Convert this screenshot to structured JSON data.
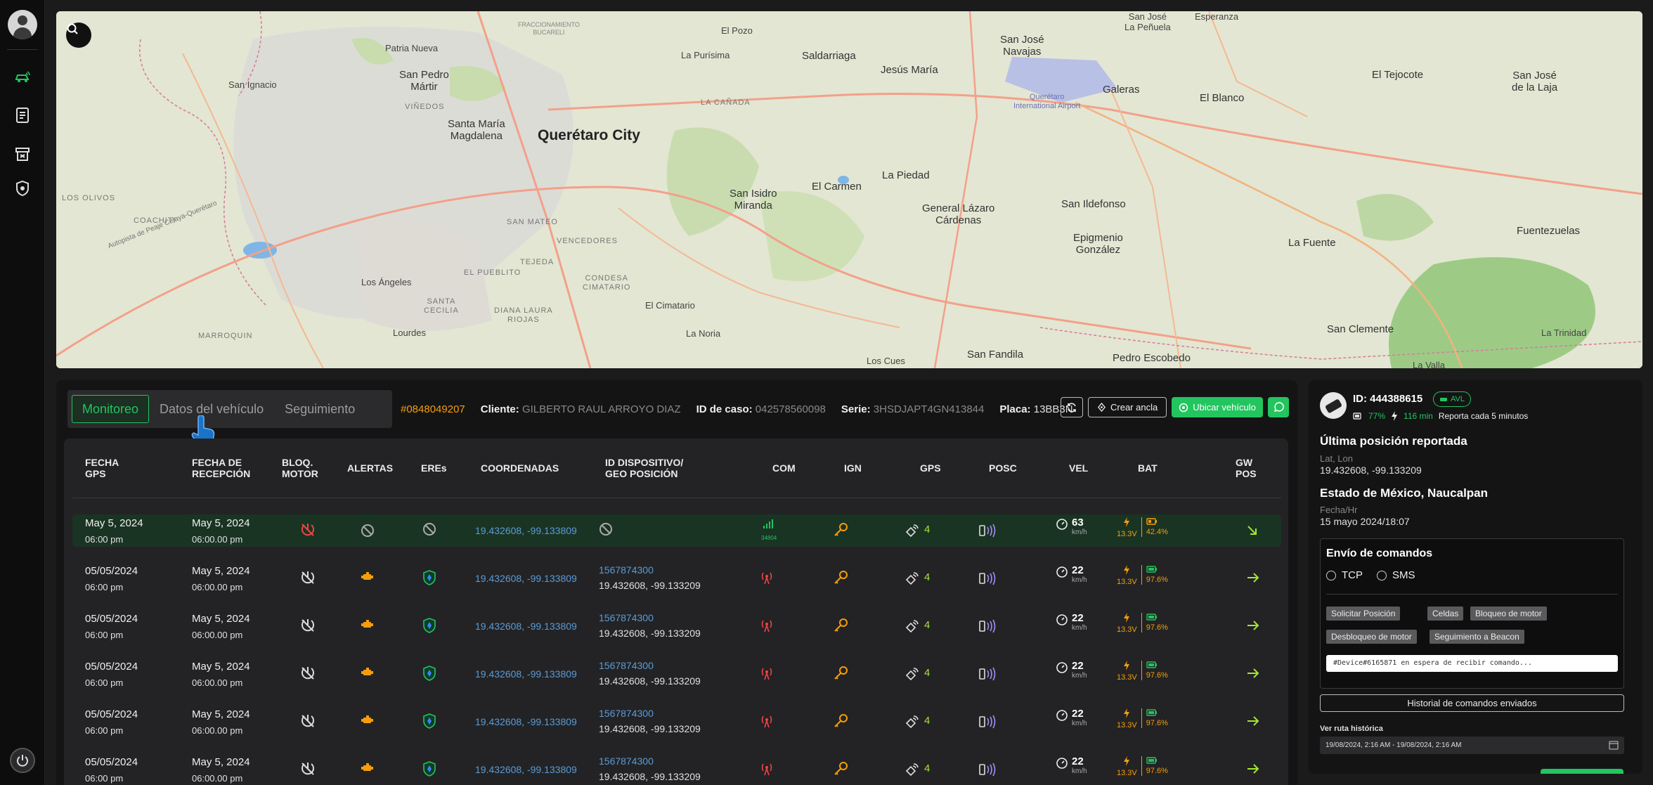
{
  "map": {
    "labels": {
      "city": "Querétaro City",
      "santa_maria": "Santa María\nMagdalena",
      "san_pedro": "San Pedro\nMártir",
      "patria_nueva": "Patria Nueva",
      "san_ignacio": "San Ignacio",
      "la_purisima": "La Purísima",
      "el_pozo": "El Pozo",
      "saldarriaga": "Saldarriaga",
      "jesus_maria": "Jesús María",
      "san_jose_navajas": "San José\nNavajas",
      "airport": "Querétaro\nInternational Airport",
      "galeras": "Galeras",
      "esperanza": "Esperanza",
      "san_jose_penuela": "San José\nLa Peñuela",
      "el_blanco": "El Blanco",
      "el_tejocote": "El Tejocote",
      "san_jose_laja": "San José\nde la Laja",
      "la_canada": "LA CAÑADA",
      "san_isidro": "San Isidro\nMiranda",
      "el_carmen": "El Carmen",
      "la_piedad": "La Piedad",
      "gral_lazaro": "General Lázaro\nCárdenas",
      "san_ildefonso": "San Ildefonso",
      "epigmenio": "Epigmenio\nGonzález",
      "la_fuente": "La Fuente",
      "fuentezuelas": "Fuentezuelas",
      "los_olivos": "LOS OLIVOS",
      "coachiti": "COACHITI",
      "san_mateo": "SAN MATEO",
      "vencedores": "VENCEDORES",
      "tejeda": "TEJEDA",
      "el_pueblito": "EL PUEBLITO",
      "condesa": "CONDESA\nCIMATARIO",
      "el_cimatario": "El Cimatario",
      "los_angeles": "Los Ángeles",
      "santa_cecilia": "SANTA\nCECILIA",
      "diana_laura": "DIANA LAURA\nRIOJAS",
      "marroquin": "MARROQUIN",
      "lourdes": "Lourdes",
      "la_noria": "La Noria",
      "los_cues": "Los Cues",
      "san_fandila": "San Fandila",
      "pedro_escobedo": "Pedro Escobedo",
      "san_clemente": "San Clemente",
      "la_trinidad": "La Trinidad",
      "la_valla": "La Valla",
      "vinedos": "VIÑEDOS",
      "bucareli": "FRACCIONAMIENTO\nBUCARELI",
      "autopista": "Autopista de Peaje Celaya-Querétaro"
    }
  },
  "tabs": [
    "Monitoreo",
    "Datos del vehículo",
    "Seguimiento"
  ],
  "info": {
    "device_no": "#0848049207",
    "cliente_label": "Cliente:",
    "cliente": "GILBERTO RAUL ARROYO DIAZ",
    "caso_label": "ID de caso:",
    "caso": "042578560098",
    "serie_label": "Serie:",
    "serie": "3HSDJAPT4GN413844",
    "placa_label": "Placa:",
    "placa": "13BB3N"
  },
  "buttons": {
    "crear_ancla": "Crear ancla",
    "ubicar": "Ubicar vehículo"
  },
  "table": {
    "headers": [
      "FECHA\nGPS",
      "FECHA DE\nRECEPCIÓN",
      "BLOQ.\nMOTOR",
      "ALERTAS",
      "EREs",
      "COORDENADAS",
      "ID DISPOSITIVO/\nGEO POSICIÓN",
      "COM",
      "IGN",
      "GPS",
      "POSC",
      "VEL",
      "BAT",
      "GW\nPOS"
    ],
    "rows": [
      {
        "fecha": "May 5, 2024",
        "hora": "06:00 pm",
        "rec": "May 5, 2024",
        "rec_hora": "06:00.00 pm",
        "coord": "19.432608, -99.133809",
        "dev": "",
        "devcoord": "",
        "com": "34804",
        "gps": "4",
        "vel": "63",
        "unit": "km/h",
        "volt": "13.3V",
        "pct": "42.4%"
      },
      {
        "fecha": "05/05/2024",
        "hora": "06:00 pm",
        "rec": "May 5, 2024",
        "rec_hora": "06:00.00 pm",
        "coord": "19.432608, -99.133809",
        "dev": "1567874300",
        "devcoord": "19.432608, -99.133209",
        "gps": "4",
        "vel": "22",
        "unit": "km/h",
        "volt": "13.3V",
        "pct": "97.6%"
      },
      {
        "fecha": "05/05/2024",
        "hora": "06:00 pm",
        "rec": "May 5, 2024",
        "rec_hora": "06:00.00 pm",
        "coord": "19.432608, -99.133809",
        "dev": "1567874300",
        "devcoord": "19.432608, -99.133209",
        "gps": "4",
        "vel": "22",
        "unit": "km/h",
        "volt": "13.3V",
        "pct": "97.6%"
      },
      {
        "fecha": "05/05/2024",
        "hora": "06:00 pm",
        "rec": "May 5, 2024",
        "rec_hora": "06:00.00 pm",
        "coord": "19.432608, -99.133809",
        "dev": "1567874300",
        "devcoord": "19.432608, -99.133209",
        "gps": "4",
        "vel": "22",
        "unit": "km/h",
        "volt": "13.3V",
        "pct": "97.6%"
      },
      {
        "fecha": "05/05/2024",
        "hora": "06:00 pm",
        "rec": "May 5, 2024",
        "rec_hora": "06:00.00 pm",
        "coord": "19.432608, -99.133809",
        "dev": "1567874300",
        "devcoord": "19.432608, -99.133209",
        "gps": "4",
        "vel": "22",
        "unit": "km/h",
        "volt": "13.3V",
        "pct": "97.6%"
      },
      {
        "fecha": "05/05/2024",
        "hora": "06:00 pm",
        "rec": "May 5, 2024",
        "rec_hora": "06:00.00 pm",
        "coord": "19.432608, -99.133809",
        "dev": "1567874300",
        "devcoord": "19.432608, -99.133209",
        "gps": "4",
        "vel": "22",
        "unit": "km/h",
        "volt": "13.3V",
        "pct": "97.6%"
      }
    ]
  },
  "right": {
    "id": "ID: 444388615",
    "avl": "AVL",
    "battery": "77%",
    "minutes": "116 min",
    "reporta": "Reporta cada 5 minutos",
    "ultima_title": "Última posición reportada",
    "latlon_label": "Lat, Lon",
    "latlon": "19.432608, -99.133209",
    "estado": "Estado de México, Naucalpan",
    "fecha_label": "Fecha/Hr",
    "fecha": "15 mayo 2024/18:07",
    "envio_title": "Envío de comandos",
    "tcp": "TCP",
    "sms": "SMS",
    "chips": [
      "Solicitar Posición",
      "Celdas",
      "Bloqueo de motor",
      "Desbloqueo de motor",
      "Seguimiento a Beacon"
    ],
    "cmd_text": "#Device#6165871 en espera de recibir comando...",
    "historial": "Historial de comandos enviados",
    "ruta_label": "Ver ruta histórica",
    "ruta_range": "19/08/2024, 2:16 AM - 19/08/2024, 2:16 AM"
  }
}
